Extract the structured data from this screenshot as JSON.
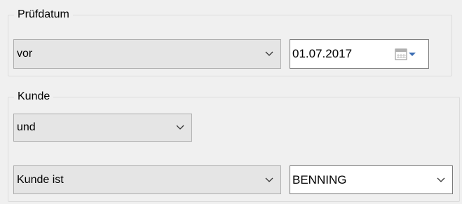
{
  "pruefdatum_group": {
    "title": "Prüfdatum",
    "operator": "vor",
    "date": "01.07.2017"
  },
  "kunde_group": {
    "title": "Kunde",
    "logic": "und",
    "field": "Kunde ist",
    "value": "BENNING"
  },
  "icons": {
    "dropdown": "chevron-down-icon",
    "calendar": "calendar-icon"
  },
  "colors": {
    "background": "#f0f0f0",
    "combo_background": "#e5e5e5",
    "input_background": "#ffffff",
    "calendar_arrow": "#3c6eb4"
  }
}
